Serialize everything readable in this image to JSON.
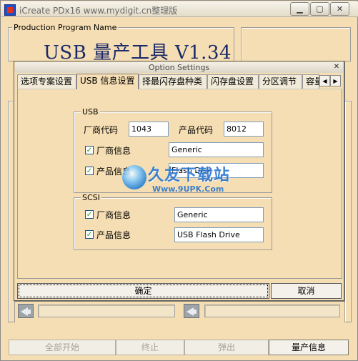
{
  "window": {
    "title": "iCreate PDx16 www.mydigit.cn整理版",
    "controls": [
      "minimize-icon",
      "maximize-icon",
      "close-icon"
    ]
  },
  "background": {
    "group_label": "Production Program Name",
    "tool_title": "USB 量产工具 V1.34",
    "bottom_buttons": [
      {
        "label": "全部开始",
        "enabled": false
      },
      {
        "label": "终止",
        "enabled": false
      },
      {
        "label": "弹出",
        "enabled": false
      },
      {
        "label": "量产信息",
        "enabled": true
      }
    ]
  },
  "dialog": {
    "title": "Option Settings",
    "tabs": [
      "选项专案设置",
      "USB 信息设置",
      "择最闪存盘种类",
      "闪存盘设置",
      "分区调节",
      "容量"
    ],
    "selected_tab": "USB 信息设置",
    "usb": {
      "label": "USB",
      "vendor_code_label": "厂商代码",
      "vendor_code": "1043",
      "product_code_label": "产品代码",
      "product_code": "8012",
      "vendor_info_label": "厂商信息",
      "vendor_info_checked": true,
      "vendor_info": "Generic",
      "product_info_label": "产品信息",
      "product_info_checked": true,
      "product_info": "Flash Disk"
    },
    "scsi": {
      "label": "SCSI",
      "vendor_info_label": "厂商信息",
      "vendor_info_checked": true,
      "vendor_info": "Generic",
      "product_info_label": "产品信息",
      "product_info_checked": true,
      "product_info": "USB Flash Drive"
    },
    "ok_label": "确定",
    "cancel_label": "取消"
  },
  "watermark": {
    "brand": "久友下载站",
    "url": "Www.9UPK.Com"
  }
}
